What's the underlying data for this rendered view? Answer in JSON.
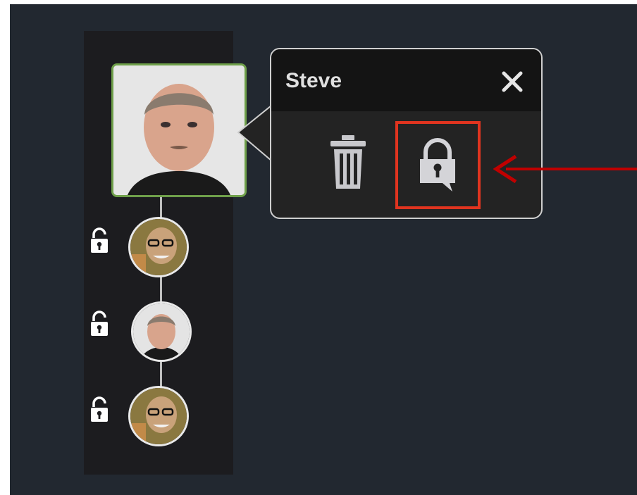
{
  "popover": {
    "title": "Steve"
  },
  "icons": {
    "close": "close-icon",
    "delete": "trash-icon",
    "private_message": "lock-message-icon",
    "lock": "lock-icon"
  },
  "colors": {
    "background": "#222830",
    "column": "#1c1c1f",
    "selected_border": "#6fa04a",
    "highlight_box": "#e0341f",
    "arrow": "#c00000"
  }
}
